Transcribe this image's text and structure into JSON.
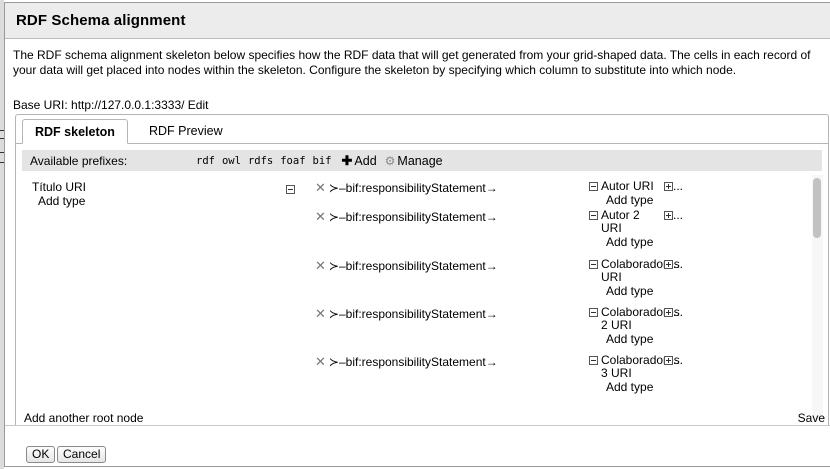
{
  "dialog": {
    "title": "RDF Schema alignment",
    "description": "The RDF schema alignment skeleton below specifies how the RDF data that will get generated from your grid-shaped data. The cells in each record of your data will get placed into nodes within the skeleton. Configure the skeleton by specifying which column to substitute into which node.",
    "base_uri": "Base URI: http://127.0.0.1:3333/ Edit"
  },
  "tabs": [
    {
      "label": "RDF skeleton",
      "active": true
    },
    {
      "label": "RDF Preview",
      "active": false
    }
  ],
  "prefixes": {
    "label": "Available prefixes:",
    "items": [
      "rdf",
      "owl",
      "rdfs",
      "foaf",
      "bif"
    ],
    "add_label": "Add",
    "manage_label": "Manage"
  },
  "skeleton": {
    "root": {
      "title": "Título URI",
      "add_type": "Add type"
    },
    "links": [
      {
        "property": "bif:responsibilityStatement",
        "target": "Autor URI",
        "add_type": "Add type"
      },
      {
        "property": "bif:responsibilityStatement",
        "target": "Autor 2 URI",
        "add_type": "Add type"
      },
      {
        "property": "bif:responsibilityStatement",
        "target": "Colaboradores URI",
        "add_type": "Add type"
      },
      {
        "property": "bif:responsibilityStatement",
        "target": "Colaboradores 2 URI",
        "add_type": "Add type"
      },
      {
        "property": "bif:responsibilityStatement",
        "target": "Colaboradores 3 URI",
        "add_type": "Add type"
      }
    ],
    "ellipsis": "...",
    "add_root_label": "Add another root node",
    "save_label": "Save"
  },
  "footer": {
    "ok_label": "OK",
    "cancel_label": "Cancel"
  },
  "icons": {
    "collapse": "collapse-box-icon",
    "expand": "expand-box-icon",
    "remove": "x-remove-icon",
    "add": "plus-icon",
    "manage": "gear-icon"
  },
  "colors": {
    "titlebar_bg": "#ececec",
    "prefix_bar_bg": "#e4e4e4",
    "border": "#b5b5b5"
  }
}
